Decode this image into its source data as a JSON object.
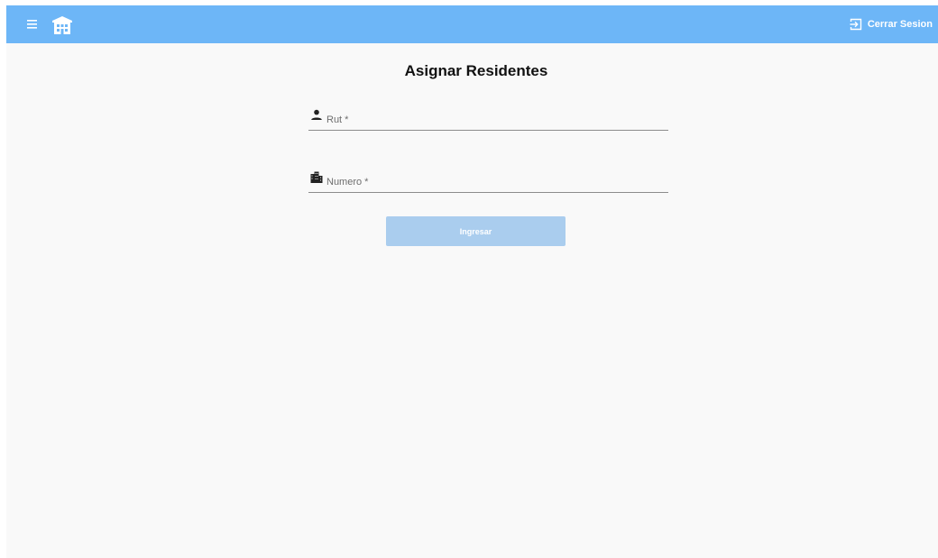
{
  "appbar": {
    "menu_icon": "hamburger-menu-icon",
    "logo_icon": "building-logo-icon",
    "logout_label": "Cerrar Sesion",
    "logout_icon": "logout-icon",
    "background_color": "#6db6f7"
  },
  "page": {
    "title": "Asignar Residentes"
  },
  "form": {
    "rut": {
      "label": "Rut *",
      "value": "",
      "icon": "person-icon"
    },
    "numero": {
      "label": "Numero *",
      "value": "",
      "icon": "apartment-icon"
    },
    "submit_label": "Ingresar",
    "submit_color": "#aacdee"
  }
}
